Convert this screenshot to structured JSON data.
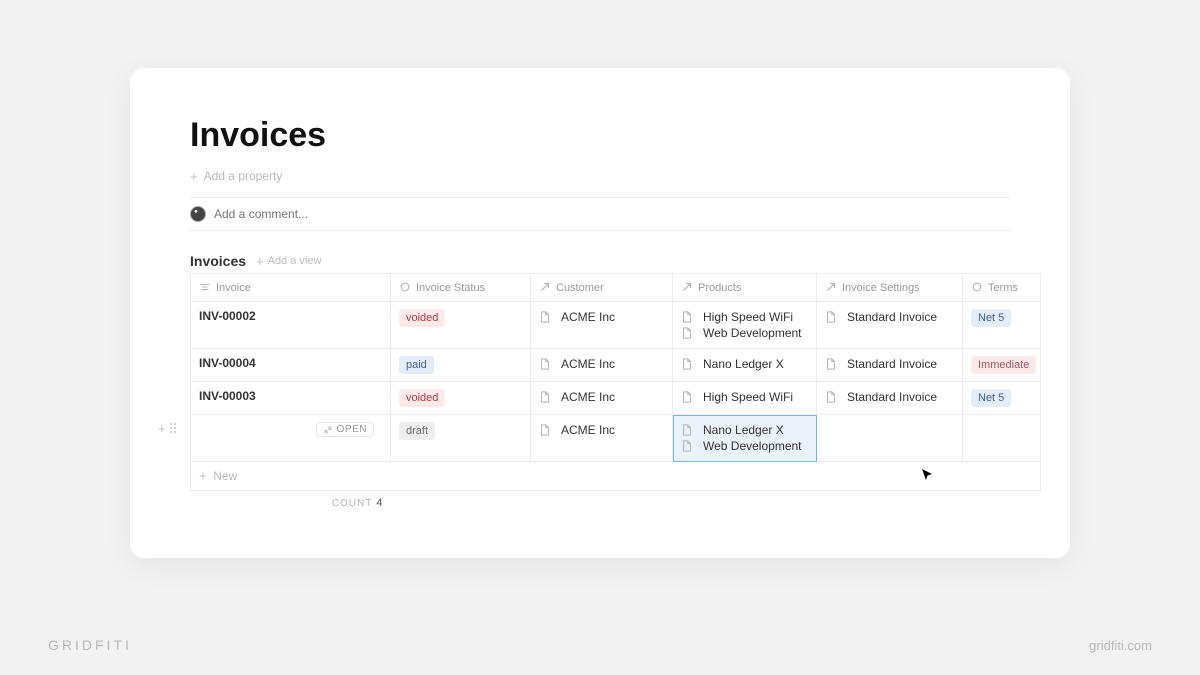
{
  "page": {
    "title": "Invoices",
    "add_property": "Add a property",
    "comment_placeholder": "Add a comment...",
    "view_title": "Invoices",
    "add_view": "Add a view",
    "new_row": "New",
    "count_label": "COUNT",
    "count_value": "4",
    "open_label": "OPEN"
  },
  "columns": {
    "invoice": "Invoice",
    "status": "Invoice Status",
    "customer": "Customer",
    "products": "Products",
    "settings": "Invoice Settings",
    "terms": "Terms"
  },
  "status_tags": {
    "voided": {
      "label": "voided",
      "class": "tag-red"
    },
    "paid": {
      "label": "paid",
      "class": "tag-blue"
    },
    "draft": {
      "label": "draft",
      "class": "tag-gray"
    }
  },
  "terms_tags": {
    "net5": {
      "label": "Net 5",
      "class": "tag-blue"
    },
    "immediate": {
      "label": "Immediate",
      "class": "tag-pink"
    }
  },
  "rows": [
    {
      "invoice": "INV-00002",
      "status": "voided",
      "customer": "ACME Inc",
      "products": [
        "High Speed WiFi",
        "Web Development"
      ],
      "settings": "Standard Invoice",
      "terms": "net5"
    },
    {
      "invoice": "INV-00004",
      "status": "paid",
      "customer": "ACME Inc",
      "products": [
        "Nano Ledger X"
      ],
      "settings": "Standard Invoice",
      "terms": "immediate"
    },
    {
      "invoice": "INV-00003",
      "status": "voided",
      "customer": "ACME Inc",
      "products": [
        "High Speed WiFi"
      ],
      "settings": "Standard Invoice",
      "terms": "net5"
    },
    {
      "invoice": "",
      "status": "draft",
      "customer": "ACME Inc",
      "products": [
        "Nano Ledger X",
        "Web Development"
      ],
      "settings": "",
      "terms": "",
      "editing": true,
      "selected_cell": "products"
    }
  ],
  "branding": {
    "left": "GRIDFITI",
    "right": "gridfiti.com"
  }
}
